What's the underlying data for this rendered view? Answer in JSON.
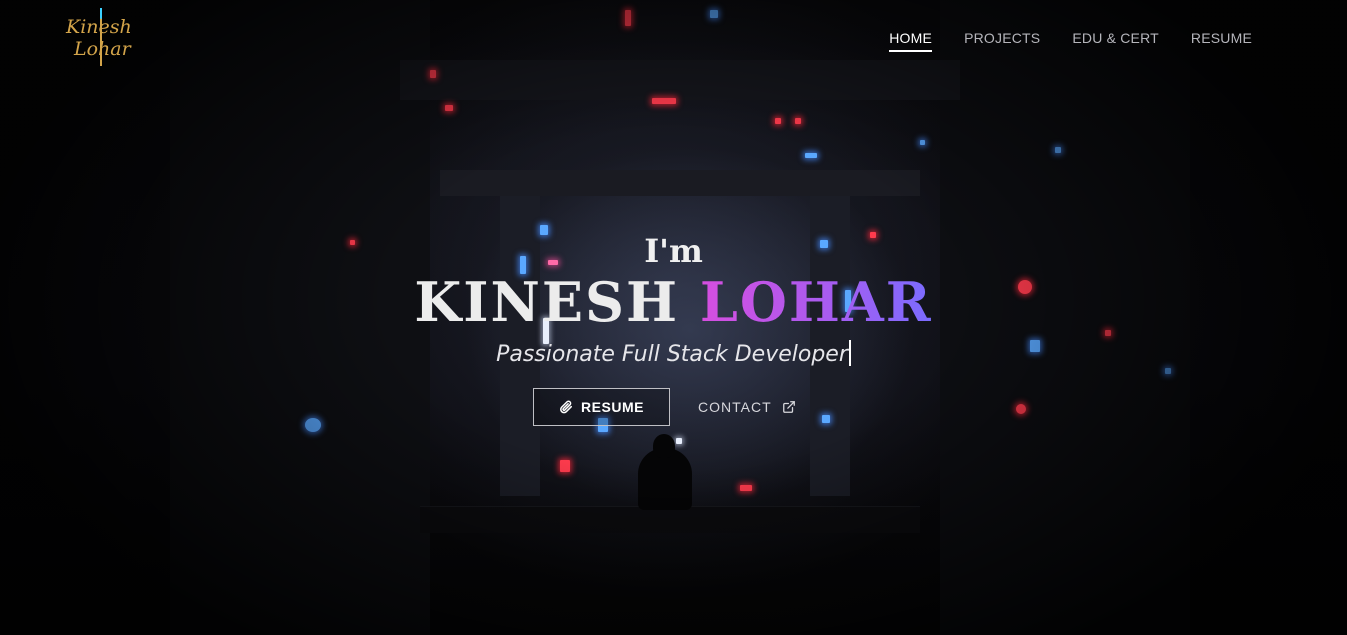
{
  "brand": {
    "line1": "Kinesh",
    "line2": "Lohar"
  },
  "nav": [
    {
      "label": "HOME",
      "active": true
    },
    {
      "label": "PROJECTS",
      "active": false
    },
    {
      "label": "EDU & CERT",
      "active": false
    },
    {
      "label": "RESUME",
      "active": false
    }
  ],
  "hero": {
    "intro": "I'm",
    "first_name": "KINESH",
    "last_name": "LOHAR",
    "tagline": "Passionate Full Stack Developer",
    "resume_button": "RESUME",
    "contact_button": "CONTACT"
  },
  "icons": {
    "resume": "paperclip-icon",
    "contact": "external-link-icon"
  },
  "colors": {
    "accent_gradient_start": "#d64ee0",
    "accent_gradient_end": "#7a6cff",
    "logo_gold": "#d3a44a"
  }
}
